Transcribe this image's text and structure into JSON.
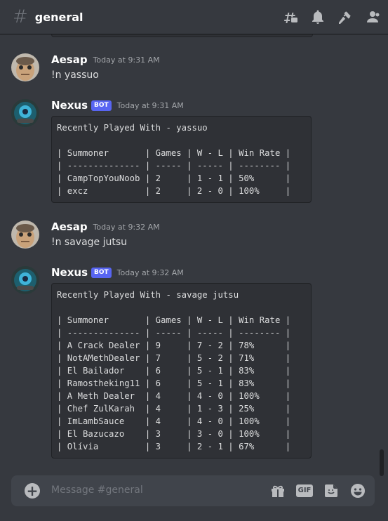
{
  "channel": {
    "hash": "#",
    "name": "general"
  },
  "header_icons": [
    "threads-icon",
    "bell-icon",
    "pin-icon",
    "members-icon"
  ],
  "messages": [
    {
      "author": "Aesap",
      "bot": false,
      "timestamp": "Today at 9:31 AM",
      "text": "!n yassuo"
    },
    {
      "author": "Nexus",
      "bot": true,
      "bot_label": "BOT",
      "timestamp": "Today at 9:31 AM",
      "code": "Recently Played With - yassuo\n\n| Summoner       | Games | W - L | Win Rate |\n| -------------- | ----- | ----- | -------- |\n| CampTopYouNoob | 2     | 1 - 1 | 50%      |\n| excz           | 2     | 2 - 0 | 100%     |"
    },
    {
      "author": "Aesap",
      "bot": false,
      "timestamp": "Today at 9:32 AM",
      "text": "!n savage jutsu"
    },
    {
      "author": "Nexus",
      "bot": true,
      "bot_label": "BOT",
      "timestamp": "Today at 9:32 AM",
      "code": "Recently Played With - savage jutsu\n\n| Summoner       | Games | W - L | Win Rate |\n| -------------- | ----- | ----- | -------- |\n| A Crack Dealer | 9     | 7 - 2 | 78%      |\n| NotAMethDealer | 7     | 5 - 2 | 71%      |\n| El Bailador    | 6     | 5 - 1 | 83%      |\n| Ramostheking11 | 6     | 5 - 1 | 83%      |\n| A Meth Dealer  | 4     | 4 - 0 | 100%     |\n| Chef ZulKarah  | 4     | 1 - 3 | 25%      |\n| ImLambSauce    | 4     | 4 - 0 | 100%     |\n| El Bazucazo    | 3     | 3 - 0 | 100%     |\n| Olívia         | 3     | 2 - 1 | 67%      |"
    }
  ],
  "composer": {
    "plus": "+",
    "placeholder": "Message #general",
    "gif_label": "GIF"
  },
  "colors": {
    "background": "#36393f",
    "code_bg": "#2f3136",
    "bot_badge": "#5865f2",
    "composer_bg": "#40444b"
  }
}
